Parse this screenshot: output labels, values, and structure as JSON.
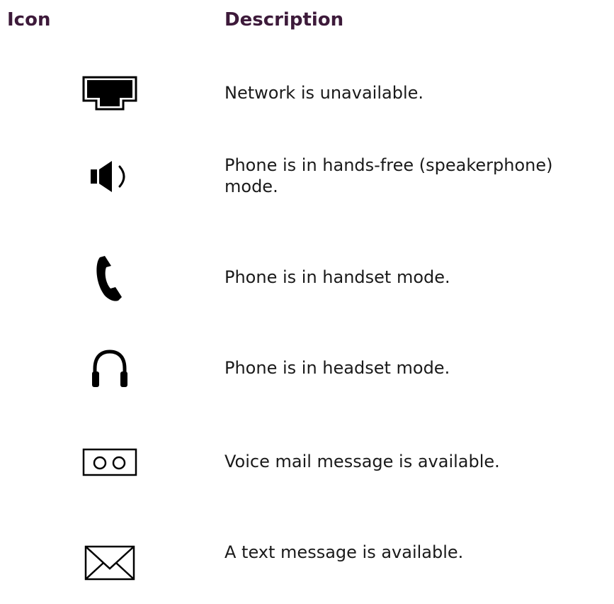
{
  "header": {
    "icon_label": "Icon",
    "description_label": "Description"
  },
  "rows": [
    {
      "icon": "network-unavailable-icon",
      "description": "Network is unavailable."
    },
    {
      "icon": "speaker-icon",
      "description": "Phone is in hands-free (speakerphone) mode."
    },
    {
      "icon": "handset-icon",
      "description": "Phone is in handset mode."
    },
    {
      "icon": "headset-icon",
      "description": "Phone is in headset mode."
    },
    {
      "icon": "voicemail-icon",
      "description": "Voice mail message is available."
    },
    {
      "icon": "envelope-icon",
      "description": "A text message is available."
    }
  ]
}
